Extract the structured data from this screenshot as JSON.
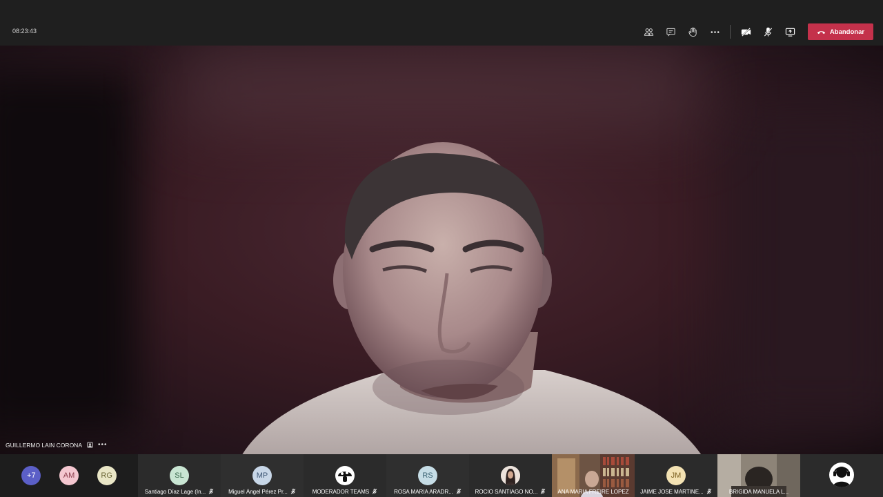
{
  "meeting": {
    "clock": "08:23:43",
    "leave_label": "Abandonar",
    "colors": {
      "leave": "#c4314b",
      "topbar": "#1f1f1f"
    }
  },
  "toolbar": {
    "icons": [
      "participants-icon",
      "chat-icon",
      "raise-hand-icon",
      "more-options-icon",
      "camera-off-icon",
      "mic-off-icon",
      "share-screen-icon"
    ]
  },
  "speaker": {
    "name": "GUILLERMO LAIN CORONA",
    "more": "•••"
  },
  "overflow": {
    "count_label": "+7",
    "avatars": [
      {
        "initials": "AM",
        "color": "#f4c7d0",
        "text_color": "#8a3b4b"
      },
      {
        "initials": "RG",
        "color": "#e9e6c6",
        "text_color": "#6a6535"
      }
    ]
  },
  "participants": [
    {
      "initials": "SL",
      "name": "Santiago Díaz Lage (In...",
      "color": "#c9e6d3",
      "text_color": "#3c6b4f"
    },
    {
      "initials": "MP",
      "name": "Miguel Ángel Pérez Pr...",
      "color": "#c8d7e8",
      "text_color": "#3d5675"
    },
    {
      "initials": "",
      "name": "MODERADOR TEAMS",
      "color": "#ffffff",
      "text_color": "#000000",
      "icon": "mushroom-logo-icon"
    },
    {
      "initials": "RS",
      "name": "ROSA MARIA ARADR...",
      "color": "#c6dde6",
      "text_color": "#3b6373"
    },
    {
      "initials": "",
      "name": "ROCIO SANTIAGO NO...",
      "color": "#e8d9cf",
      "text_color": "#000000",
      "icon": "profile-photo-icon"
    },
    {
      "initials": "",
      "name": "ANA MARIA FREIRE LOPEZ",
      "color": "#6d5444",
      "text_color": "#ffffff",
      "icon": "video-tile"
    },
    {
      "initials": "JM",
      "name": "JAIME JOSE MARTINE...",
      "color": "#f3e2b3",
      "text_color": "#7a5e1e"
    },
    {
      "initials": "",
      "name": "BRIGIDA MANUELA L...",
      "color": "#8d8478",
      "text_color": "#ffffff",
      "icon": "video-tile"
    },
    {
      "initials": "",
      "name": "",
      "color": "#ffffff",
      "text_color": "#000000",
      "icon": "headset-user-icon"
    }
  ]
}
